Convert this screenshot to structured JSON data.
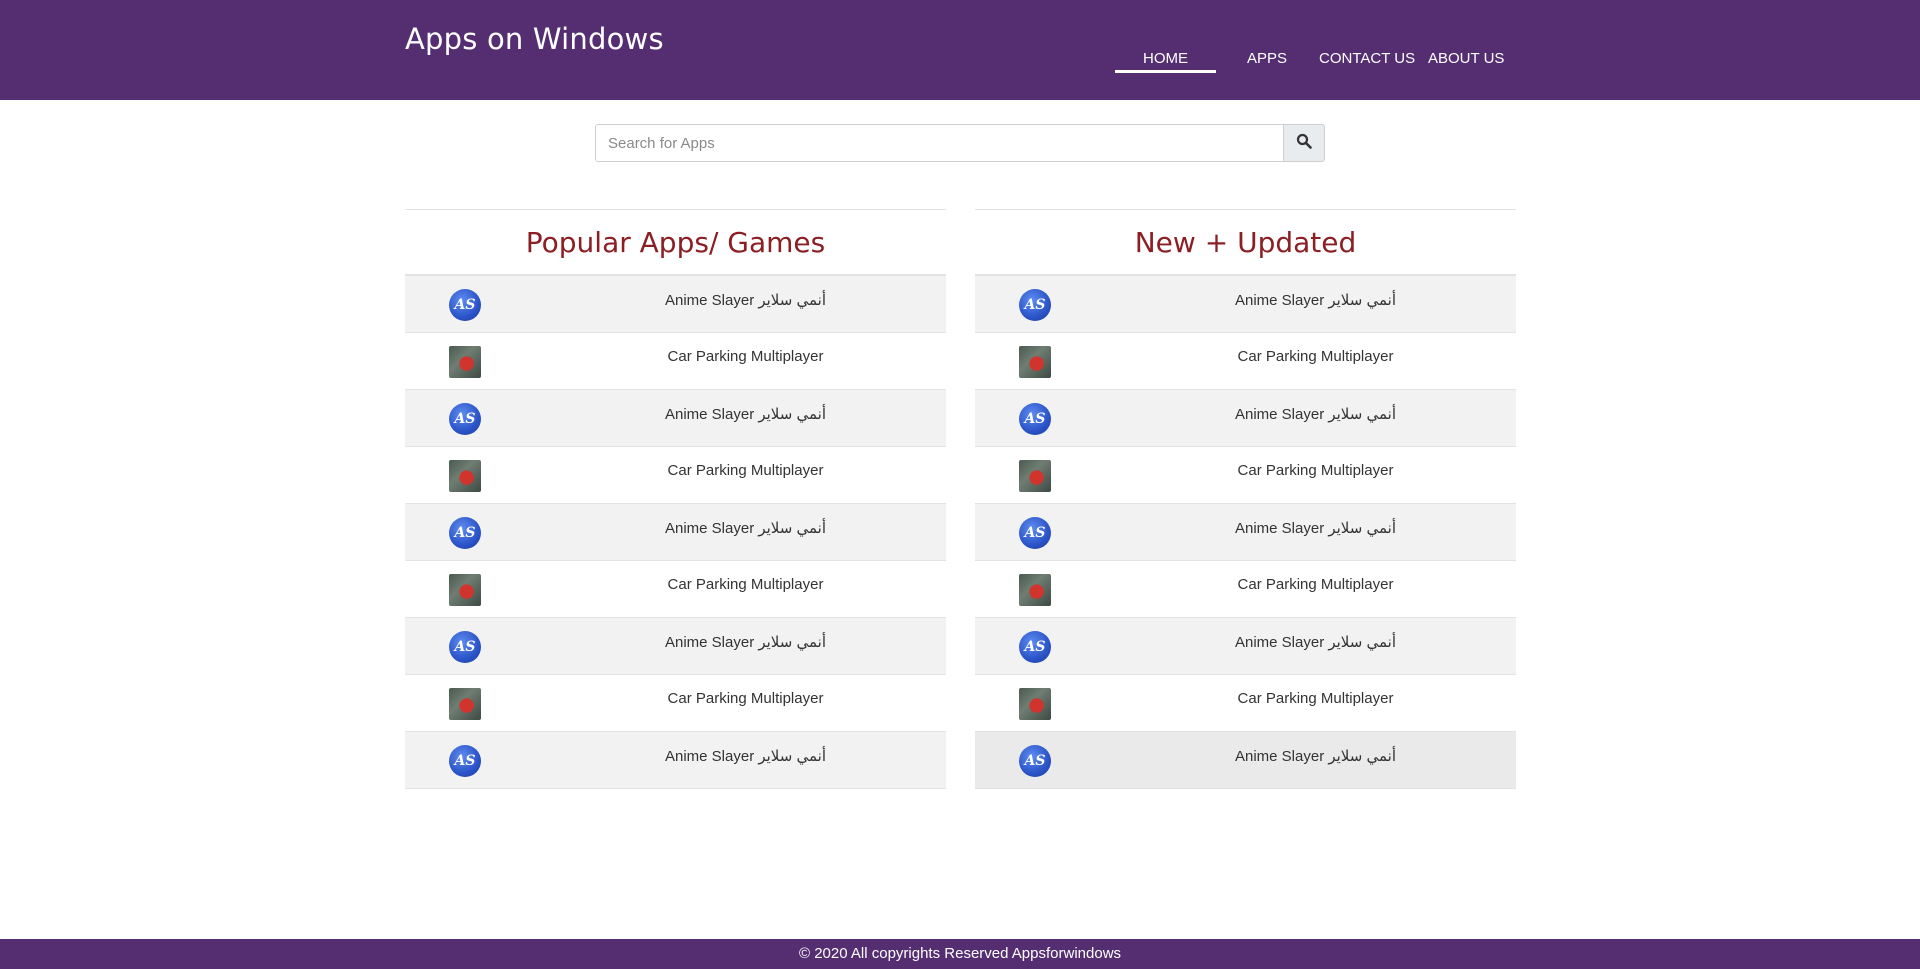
{
  "header": {
    "brand": "Apps on Windows",
    "nav": [
      {
        "label": "HOME",
        "active": true
      },
      {
        "label": "APPS",
        "active": false
      },
      {
        "label": "CONTACT US",
        "active": false
      },
      {
        "label": "ABOUT US",
        "active": false
      }
    ]
  },
  "search": {
    "placeholder": "Search for Apps",
    "value": "",
    "button_icon": "search-icon"
  },
  "popular": {
    "title": "Popular Apps/ Games",
    "items": [
      {
        "label": "Anime Slayer أنمي سلاير",
        "icon": "anime-slayer-app-icon"
      },
      {
        "label": "Car Parking Multiplayer",
        "icon": "car-parking-app-icon"
      },
      {
        "label": "Anime Slayer أنمي سلاير",
        "icon": "anime-slayer-app-icon"
      },
      {
        "label": "Car Parking Multiplayer",
        "icon": "car-parking-app-icon"
      },
      {
        "label": "Anime Slayer أنمي سلاير",
        "icon": "anime-slayer-app-icon"
      },
      {
        "label": "Car Parking Multiplayer",
        "icon": "car-parking-app-icon"
      },
      {
        "label": "Anime Slayer أنمي سلاير",
        "icon": "anime-slayer-app-icon"
      },
      {
        "label": "Car Parking Multiplayer",
        "icon": "car-parking-app-icon"
      },
      {
        "label": "Anime Slayer أنمي سلاير",
        "icon": "anime-slayer-app-icon"
      }
    ]
  },
  "updated": {
    "title": "New + Updated",
    "items": [
      {
        "label": "Anime Slayer أنمي سلاير",
        "icon": "anime-slayer-app-icon"
      },
      {
        "label": "Car Parking Multiplayer",
        "icon": "car-parking-app-icon"
      },
      {
        "label": "Anime Slayer أنمي سلاير",
        "icon": "anime-slayer-app-icon"
      },
      {
        "label": "Car Parking Multiplayer",
        "icon": "car-parking-app-icon"
      },
      {
        "label": "Anime Slayer أنمي سلاير",
        "icon": "anime-slayer-app-icon"
      },
      {
        "label": "Car Parking Multiplayer",
        "icon": "car-parking-app-icon"
      },
      {
        "label": "Anime Slayer أنمي سلاير",
        "icon": "anime-slayer-app-icon"
      },
      {
        "label": "Car Parking Multiplayer",
        "icon": "car-parking-app-icon"
      },
      {
        "label": "Anime Slayer أنمي سلاير",
        "icon": "anime-slayer-app-icon"
      }
    ]
  },
  "footer": {
    "text": "© 2020 All copyrights Reserved Appsforwindows"
  },
  "colors": {
    "header_bg": "#552e72",
    "heading": "#8b1f24",
    "row_alt": "#f2f2f2"
  }
}
